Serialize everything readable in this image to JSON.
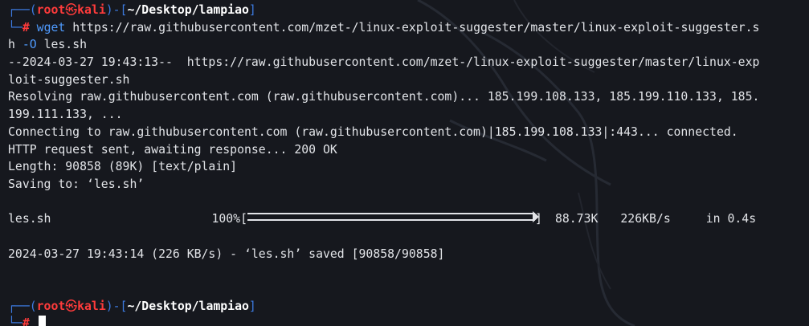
{
  "prompt": {
    "frame_top": "┌──(",
    "user": "root",
    "skull": "㉿",
    "host": "kali",
    "mid": ")-[",
    "path": "~/Desktop/lampiao",
    "close": "]",
    "frame_bottom": "└─",
    "hash": "#"
  },
  "command": {
    "program": "wget",
    "url_part1": " https://raw.githubusercontent.com/mzet-/linux-exploit-suggester/master/linux-exploit-suggester.s",
    "url_part2": "h",
    "option": " -O",
    "filename": " les.sh"
  },
  "output": {
    "line1": "--2024-03-27 19:43:13--  https://raw.githubusercontent.com/mzet-/linux-exploit-suggester/master/linux-exp",
    "line2": "loit-suggester.sh",
    "line3": "Resolving raw.githubusercontent.com (raw.githubusercontent.com)... 185.199.108.133, 185.199.110.133, 185.",
    "line4": "199.111.133, ...",
    "line5": "Connecting to raw.githubusercontent.com (raw.githubusercontent.com)|185.199.108.133|:443... connected.",
    "line6": "HTTP request sent, awaiting response... 200 OK",
    "line7": "Length: 90858 (89K) [text/plain]",
    "line8": "Saving to: ‘les.sh’",
    "progress": {
      "file": "les.sh",
      "percent": "100%",
      "fraction": 1.0,
      "bracket_open": "[",
      "bracket_close": "]",
      "size": "88.73K",
      "speed": "226KB/s",
      "eta": "in 0.4s"
    },
    "saved_line": "2024-03-27 19:43:14 (226 KB/s) - ‘les.sh’ saved [90858/90858]"
  }
}
